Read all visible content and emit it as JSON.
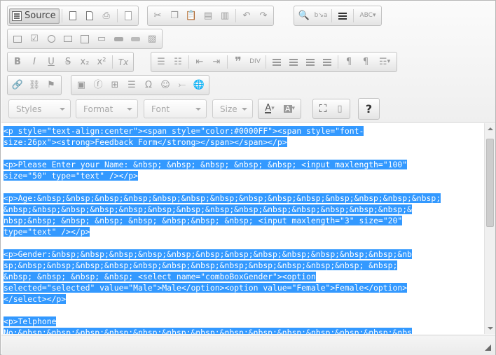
{
  "toolbar": {
    "source_label": "Source",
    "styles_label": "Styles",
    "format_label": "Format",
    "font_label": "Font",
    "size_label": "Size",
    "text_color_glyph": "A",
    "bg_color_glyph": "A",
    "help_glyph": "?",
    "bold_glyph": "B",
    "italic_glyph": "I",
    "underline_glyph": "U",
    "strike_glyph": "S",
    "subscript_glyph": "x₂",
    "superscript_glyph": "x²",
    "remove_format_glyph": "Tx",
    "omega_glyph": "Ω",
    "spell_glyph": "ABC"
  },
  "source_lines": [
    "<p style=\"text-align:center\"><span style=\"color:#0000FF\"><span style=\"font-",
    "size:26px\"><strong>Feedback Form</strong></span></span></p>",
    "",
    "<p>Please Enter your Name: &nbsp; &nbsp; &nbsp; &nbsp; &nbsp; <input maxlength=\"100\"",
    "size=\"50\" type=\"text\" /></p>",
    "",
    "<p>Age:&nbsp;&nbsp;&nbsp;&nbsp;&nbsp;&nbsp;&nbsp;&nbsp;&nbsp;&nbsp;&nbsp;&nbsp;&nbsp;&nbsp;",
    "&nbsp;&nbsp;&nbsp;&nbsp;&nbsp;&nbsp;&nbsp;&nbsp;&nbsp;&nbsp;&nbsp;&nbsp;&nbsp;&nbsp;&",
    "nbsp;&nbsp; &nbsp; &nbsp; &nbsp; &nbsp;&nbsp; &nbsp; <input maxlength=\"3\" size=\"20\"",
    "type=\"text\" /></p>",
    "",
    "<p>Gender:&nbsp;&nbsp;&nbsp;&nbsp;&nbsp;&nbsp;&nbsp;&nbsp;&nbsp;&nbsp;&nbsp;&nbsp;&nb",
    "sp;&nbsp;&nbsp;&nbsp;&nbsp;&nbsp;&nbsp;&nbsp;&nbsp;&nbsp;&nbsp;&nbsp;&nbsp; &nbsp;",
    "&nbsp; &nbsp; &nbsp; &nbsp; <select name=\"comboBoxGender\"><option",
    "selected=\"selected\" value=\"Male\">Male</option><option value=\"Female\">Female</option>",
    "</select></p>",
    "",
    "<p>Telphone",
    "No:&nbsp;&nbsp;&nbsp;&nbsp;&nbsp;&nbsp;&nbsp;&nbsp;&nbsp;&nbsp;&nbsp;&nbsp;&nbsp;&nbs"
  ]
}
